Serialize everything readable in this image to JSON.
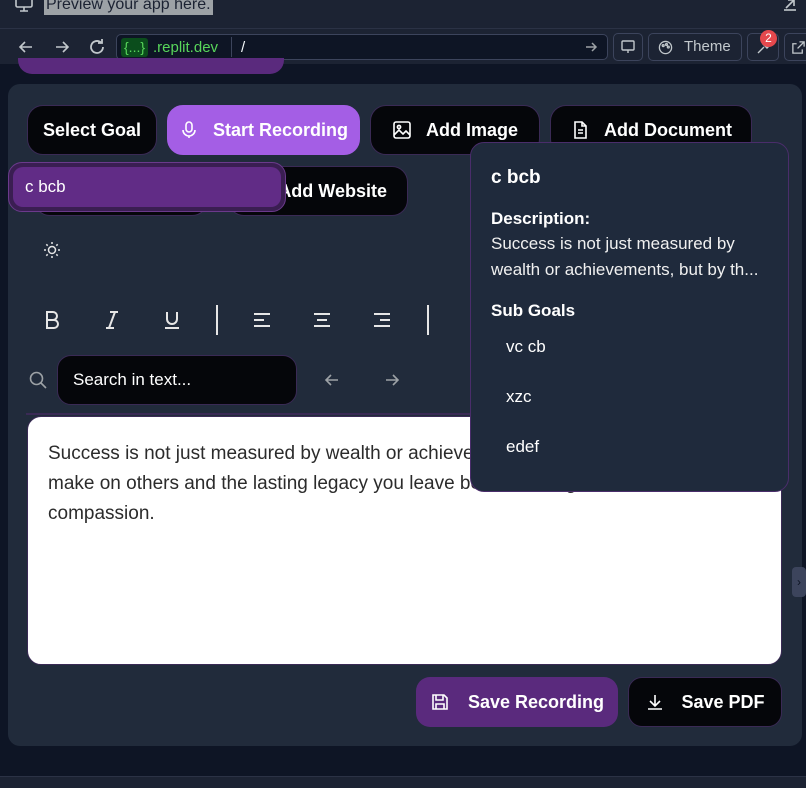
{
  "preview": {
    "placeholder_text": "Preview your app here."
  },
  "browser": {
    "url_pill": "{...}",
    "url_domain": ".replit.dev",
    "url_path": "/",
    "theme_label": "Theme",
    "notification_count": "2"
  },
  "toolbar": {
    "select_goal": "Select Goal",
    "start_recording": "Start Recording",
    "add_image": "Add Image",
    "add_document": "Add Document",
    "add_website": "Add Website"
  },
  "goal_input": {
    "value": "c bcb"
  },
  "search": {
    "placeholder": "Search in text..."
  },
  "editor": {
    "text": "Success is not just measured by wealth or achievements, but by the impact you make on others and the lasting legacy you leave behind through kindness and compassion."
  },
  "actions": {
    "save_recording": "Save Recording",
    "save_pdf": "Save PDF"
  },
  "popover": {
    "title": "c bcb",
    "description_label": "Description:",
    "description_line1": "Success is not just measured by",
    "description_line2": "wealth or achievements, but by th...",
    "sub_goals_label": "Sub Goals",
    "sub_goals": [
      "vc cb",
      "xzc",
      "edef"
    ]
  },
  "colors": {
    "accent_purple": "#a45ee5",
    "dark_purple": "#5a2a7d",
    "card_bg": "#212b3b",
    "url_green": "#58d65b"
  }
}
